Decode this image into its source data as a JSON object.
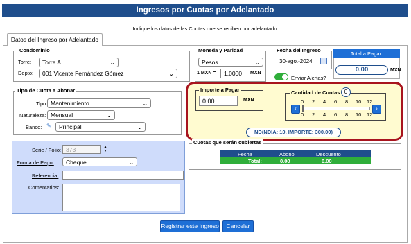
{
  "title": "Ingresos por Cuotas por Adelantado",
  "instructions": "Indique los datos de las Cuotas que se reciben por adelantado:",
  "tab_label": "Datos del Ingreso por Adelantado",
  "condominio": {
    "legend": "Condominio",
    "torre_label": "Torre:",
    "torre_value": "Torre A",
    "depto_label": "Depto:",
    "depto_value": "001 Vicente Fernández Gómez"
  },
  "moneda": {
    "legend": "Moneda y Paridad",
    "value": "Pesos",
    "paridad_prefix": "1 MXN =",
    "paridad_value": "1.0000",
    "paridad_suffix": "MXN"
  },
  "fecha": {
    "legend": "Fecha del Ingreso",
    "value": "30-ago.-2024",
    "toggle_label": "Enviar Alertas?",
    "toggle_on": true
  },
  "total": {
    "header": "Total a Pagar:",
    "value": "0.00",
    "currency": "MXN"
  },
  "tipo_cuota": {
    "legend": "Tipo de Cuota a Abonar",
    "tipo_label": "Tipo:",
    "tipo_value": "Mantenimiento",
    "naturaleza_label": "Naturaleza:",
    "naturaleza_value": "Mensual",
    "banco_label": "Banco:",
    "banco_value": "Principal"
  },
  "importe": {
    "legend": "Importe a Pagar",
    "value": "0.00",
    "currency": "MXN"
  },
  "cantidad": {
    "legend": "Cantidad de Cuotas:",
    "value": "0",
    "ticks_top": [
      "0",
      "2",
      "4",
      "6",
      "8",
      "10",
      "12"
    ],
    "ticks_bottom": [
      "0",
      "2",
      "4",
      "6",
      "8",
      "10",
      "12"
    ]
  },
  "nd_button": "ND(NDIA: 10, IMPORTE: 300.00)",
  "pago": {
    "serie_label": "Serie / Folio:",
    "serie_value": "373",
    "forma_label": "Forma de Pago:",
    "forma_value": "Cheque",
    "referencia_label": "Referencia:",
    "referencia_value": "",
    "comentarios_label": "Comentarios:",
    "comentarios_value": ""
  },
  "cubiertas": {
    "legend": "Cuotas que serán cubiertas",
    "headers": [
      "Fecha",
      "Abono",
      "Descuento"
    ],
    "total_label": "Total:",
    "total_abono": "0.00",
    "total_descuento": "0.00"
  },
  "buttons": {
    "register": "Registrar este Ingreso",
    "cancel": "Cancelar"
  },
  "colors": {
    "title_bar": "#1f4e8c",
    "accent_blue": "#1e6fd6",
    "highlight_border": "#a8141e",
    "highlight_fill": "#fffbd0",
    "total_green": "#2fae3a",
    "pago_panel": "#cfdcfb"
  }
}
